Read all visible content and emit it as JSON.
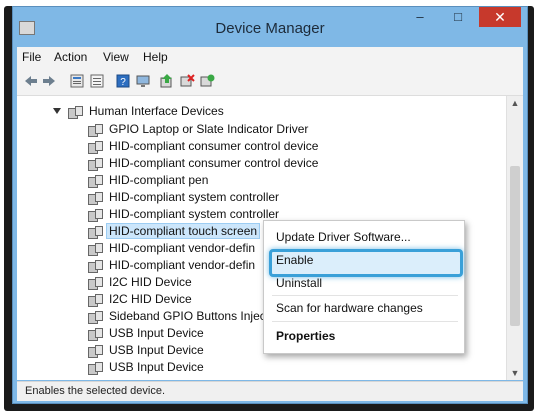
{
  "window": {
    "title": "Device Manager",
    "minimize": "–",
    "maximize": "□",
    "close": "✕"
  },
  "menu": [
    "File",
    "Action",
    "View",
    "Help"
  ],
  "toolbar_icons": [
    "back-icon",
    "forward-icon",
    "properties-icon",
    "show-hidden-icon",
    "help-icon",
    "computer-icon",
    "update-driver-icon",
    "uninstall-icon",
    "scan-hardware-icon"
  ],
  "tree": {
    "category": "Human Interface Devices",
    "items": [
      "GPIO Laptop or Slate Indicator Driver",
      "HID-compliant consumer control device",
      "HID-compliant consumer control device",
      "HID-compliant pen",
      "HID-compliant system controller",
      "HID-compliant system controller",
      "HID-compliant touch screen",
      "HID-compliant vendor-defin",
      "HID-compliant vendor-defin",
      "I2C HID Device",
      "I2C HID Device",
      "Sideband GPIO Buttons Injec",
      "USB Input Device",
      "USB Input Device",
      "USB Input Device"
    ]
  },
  "context_menu": {
    "update_driver": "Update Driver Software...",
    "enable": "Enable",
    "uninstall": "Uninstall",
    "scan": "Scan for hardware changes",
    "properties": "Properties"
  },
  "status": "Enables the selected device."
}
